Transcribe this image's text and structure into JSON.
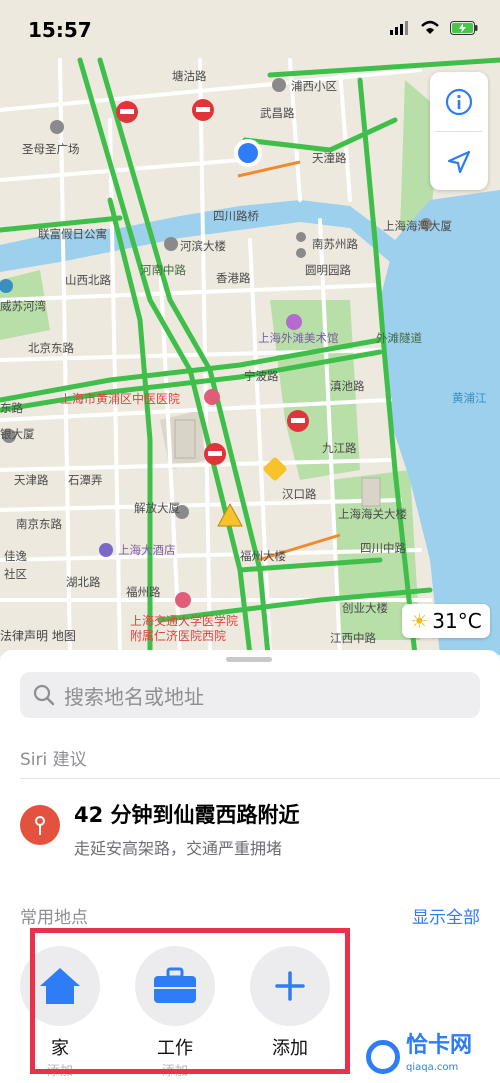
{
  "status": {
    "time": "15:57"
  },
  "map": {
    "labels": {
      "tangshan_rd": "塘沽路",
      "pusixi": "浦西小区",
      "wuchang_rd": "武昌路",
      "shengmu": "圣母圣广场",
      "tianjin_rd": "天潼路",
      "sichuan_bridge": "四川路桥",
      "shanghai_bay": "上海海湾大厦",
      "lianfu": "联富假日公寓",
      "hebin": "河滨大楼",
      "nansuzhou_rd": "南苏州路",
      "shanxi_n_rd": "山西北路",
      "suzhou_creek": "威苏河湾",
      "xianggang_rd": "香港路",
      "yuanmingyuan": "圆明园路",
      "henan_zhong": "河南中路",
      "beijing_rd": "北京东路",
      "waitan_museum": "上海外滩美术馆",
      "ningbo_rd": "宁波路",
      "dianchi_rd": "滇池路",
      "waitan_tunnel": "外滩隧道",
      "huangpu_river": "黄浦江",
      "zhongyi_hospital": "上海市黄浦区中医医院",
      "bank_bldg": "银大厦",
      "jiujiang_rd": "九江路",
      "tianjin_rd2": "天津路",
      "shixian_rd": "石潭弄",
      "jiefang": "解放大厦",
      "hankou_rd": "汉口路",
      "customs": "上海海关大楼",
      "nanjing_rd": "南京东路",
      "jiasha": "佳逸",
      "shequ": "社区",
      "shanghai_hotel": "上海大酒店",
      "fuzhou_bldg": "福州大楼",
      "hubei_rd": "湖北路",
      "guangzhou_rd": "福州路",
      "sichuan_zhong": "四川中路",
      "jiaoda": "上海交通大学医学院",
      "renji": "附属仁济医院西院",
      "chuangye": "创业大楼",
      "jiangxi_zhong": "江西中路",
      "dongfeng_rd": "东路"
    },
    "legal": "法律声明 地图",
    "weather": "31°C"
  },
  "search": {
    "placeholder": "搜索地名或地址"
  },
  "siri": {
    "title": "Siri 建议",
    "headline": "42 分钟到仙霞西路附近",
    "detail": "走延安高架路，交通严重拥堵"
  },
  "favorites": {
    "title": "常用地点",
    "show_all": "显示全部",
    "items": [
      {
        "label": "家",
        "sub": "添加",
        "icon": "house-icon"
      },
      {
        "label": "工作",
        "sub": "添加",
        "icon": "briefcase-icon"
      },
      {
        "label": "添加",
        "sub": "",
        "icon": "plus-icon"
      }
    ]
  },
  "watermark": {
    "name": "恰卡网",
    "url": "qiaqa.com"
  },
  "colors": {
    "accent": "#2e7cf6",
    "road_green": "#3fbf4a",
    "annotation_red": "#e8314a",
    "pin_red": "#e4513f",
    "water": "#9cd0ec"
  }
}
